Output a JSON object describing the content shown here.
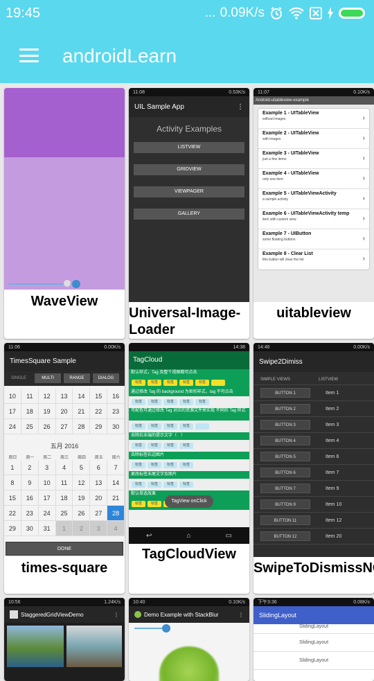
{
  "status_bar": {
    "time": "19:45",
    "dots": "...",
    "network_speed": "0.09K/s"
  },
  "app_bar": {
    "title": "androidLearn"
  },
  "items": [
    {
      "label": "WaveView"
    },
    {
      "label": "Universal-Image-Loader",
      "mock": {
        "status": "11:08",
        "speed": "0.53K/s",
        "title": "UIL Sample App",
        "heading": "Activity Examples",
        "buttons": [
          "LISTVIEW",
          "GRIDVIEW",
          "VIEWPAGER",
          "GALLERY"
        ]
      }
    },
    {
      "label": "uitableview",
      "mock": {
        "status": "11:07",
        "speed": "0.10K/s",
        "title": "Android-uitableview-example",
        "rows": [
          {
            "t": "Example 1 - UITableView",
            "s": "without images"
          },
          {
            "t": "Example 2 - UITableView",
            "s": "with images"
          },
          {
            "t": "Example 3 - UITableView",
            "s": "just a few items"
          },
          {
            "t": "Example 4 - UITableView",
            "s": "only one item"
          },
          {
            "t": "Example 5 - UITableViewActivity",
            "s": "a sample activity"
          },
          {
            "t": "Example 6 - UITableViewActivity temp",
            "s": "item with custom view"
          },
          {
            "t": "Example 7 - UIButton",
            "s": "some floating buttons"
          },
          {
            "t": "Example 8 - Clear List",
            "s": "this button will clear the list"
          }
        ]
      }
    },
    {
      "label": "times-square",
      "mock": {
        "status": "11:06",
        "speed": "0.00K/s",
        "title": "TimesSquare Sample",
        "tabs": [
          "SINGLE",
          "MULTI",
          "RANGE",
          "DIALOG"
        ],
        "rows_top": [
          [
            "10",
            "11",
            "12",
            "13",
            "14",
            "15",
            "16"
          ],
          [
            "17",
            "18",
            "19",
            "20",
            "21",
            "22",
            "23"
          ],
          [
            "24",
            "25",
            "26",
            "27",
            "28",
            "29",
            "30"
          ]
        ],
        "month": "五月 2016",
        "weekdays": [
          "周日",
          "周一",
          "周二",
          "周三",
          "周四",
          "周五",
          "周六"
        ],
        "rows": [
          [
            "1",
            "2",
            "3",
            "4",
            "5",
            "6",
            "7"
          ],
          [
            "8",
            "9",
            "10",
            "11",
            "12",
            "13",
            "14"
          ],
          [
            "15",
            "16",
            "17",
            "18",
            "19",
            "20",
            "21"
          ],
          [
            "22",
            "23",
            "24",
            "25",
            "26",
            "27",
            "28"
          ],
          [
            "29",
            "30",
            "31",
            "1",
            "2",
            "3",
            "4"
          ]
        ],
        "done": "DONE"
      }
    },
    {
      "label": "TagCloudView",
      "mock": {
        "status": "14:38",
        "title": "TagCloud",
        "heads": [
          "默认样式，Tag 及整个视图都可点击",
          "通过修改 Tag 的 background 为矩形样式，tag 不可点击",
          "可配色可通过修改 Tag 对应的资源文件来实现 不同的 Tag 样式",
          "去除右末端的提示文字（　）",
          "去除标签右边图片",
          "更改标签末尾文字及图片",
          "默认单选效果"
        ],
        "chip": "标签",
        "toast": "TagView onClick"
      }
    },
    {
      "label": "SwipeToDismissNOA",
      "mock": {
        "status": "14:46",
        "speed": "0.00K/s",
        "title": "Swipe2Dimiss",
        "col_a": "SIMPLE VIEWS",
        "col_b": "LISTVIEW",
        "buttons": [
          "BUTTON 1",
          "BUTTON 2",
          "BUTTON 3",
          "BUTTON 4",
          "BUTTON 5",
          "BUTTON 6",
          "BUTTON 7",
          "BUTTON 9",
          "BUTTON 11",
          "BUTTON 12"
        ],
        "list": [
          "Item 1",
          "Item 2",
          "Item 3",
          "Item 4",
          "Item 6",
          "Item 7",
          "Item 9",
          "Item 10",
          "Item 12",
          "Item 20"
        ]
      }
    },
    {
      "label": "",
      "mock": {
        "status": "10:56",
        "speed": "1.24K/s",
        "title": "StaggeredGridViewDemo"
      }
    },
    {
      "label": "",
      "mock": {
        "status": "10:40",
        "speed": "0.10K/s",
        "title": "Demo Example with StackBlur"
      }
    },
    {
      "label": "",
      "mock": {
        "status": "下午3:36",
        "speed": "0.08K/s",
        "title": "SlidingLayout",
        "rows": [
          "SlidingLayout",
          "SlidingLayout",
          "SlidingLayout"
        ]
      }
    }
  ],
  "colors": {
    "primary": "#5ad8ee",
    "accent_blue": "#3f8ccf",
    "tag_green": "#0d9f57",
    "wave_purple": "#b47fd6"
  }
}
